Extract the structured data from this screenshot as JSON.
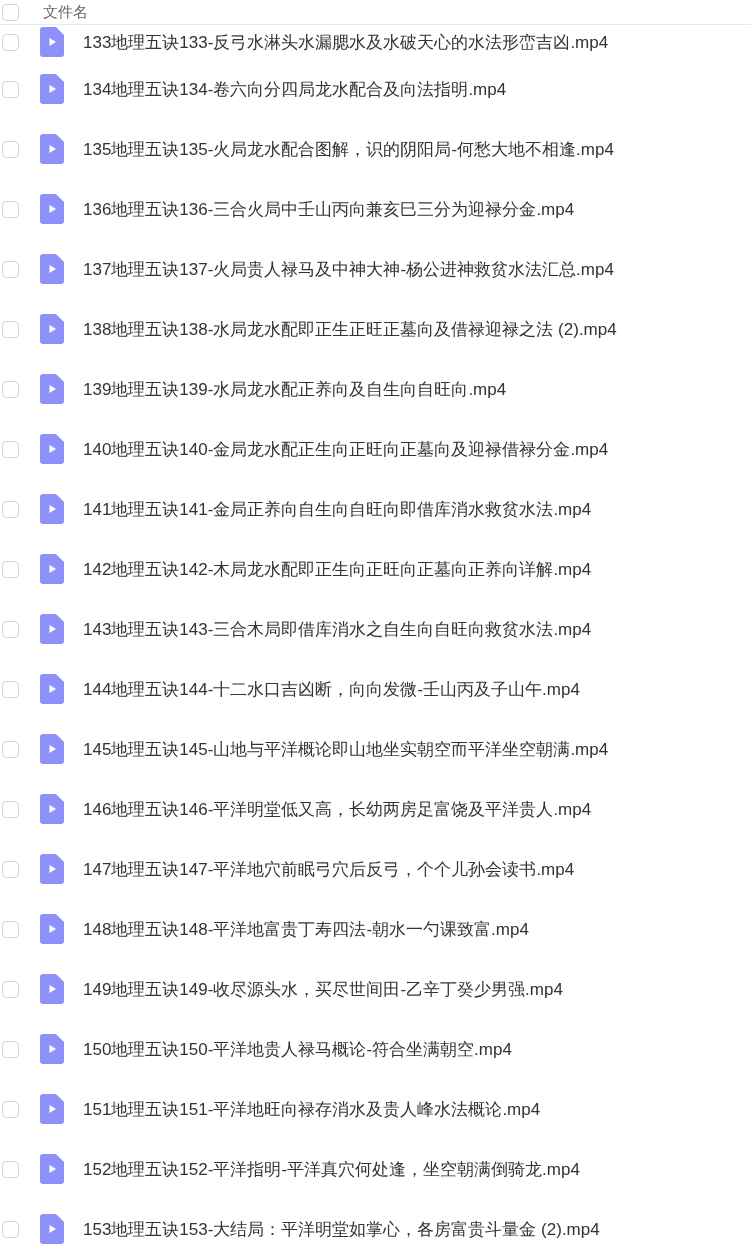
{
  "header": {
    "checked": false,
    "label": "文件名"
  },
  "files": [
    {
      "name": "133地理五诀133-反弓水淋头水漏腮水及水破天心的水法形峦吉凶.mp4",
      "checked": false
    },
    {
      "name": "134地理五诀134-卷六向分四局龙水配合及向法指明.mp4",
      "checked": false
    },
    {
      "name": "135地理五诀135-火局龙水配合图解，识的阴阳局-何愁大地不相逢.mp4",
      "checked": false
    },
    {
      "name": "136地理五诀136-三合火局中壬山丙向兼亥巳三分为迎禄分金.mp4",
      "checked": false
    },
    {
      "name": "137地理五诀137-火局贵人禄马及中神大神-杨公进神救贫水法汇总.mp4",
      "checked": false
    },
    {
      "name": "138地理五诀138-水局龙水配即正生正旺正墓向及借禄迎禄之法 (2).mp4",
      "checked": false
    },
    {
      "name": "139地理五诀139-水局龙水配正养向及自生向自旺向.mp4",
      "checked": false
    },
    {
      "name": "140地理五诀140-金局龙水配正生向正旺向正墓向及迎禄借禄分金.mp4",
      "checked": false
    },
    {
      "name": "141地理五诀141-金局正养向自生向自旺向即借库消水救贫水法.mp4",
      "checked": false
    },
    {
      "name": "142地理五诀142-木局龙水配即正生向正旺向正墓向正养向详解.mp4",
      "checked": false
    },
    {
      "name": "143地理五诀143-三合木局即借库消水之自生向自旺向救贫水法.mp4",
      "checked": false
    },
    {
      "name": "144地理五诀144-十二水口吉凶断，向向发微-壬山丙及子山午.mp4",
      "checked": false
    },
    {
      "name": "145地理五诀145-山地与平洋概论即山地坐实朝空而平洋坐空朝满.mp4",
      "checked": false
    },
    {
      "name": "146地理五诀146-平洋明堂低又高，长幼两房足富饶及平洋贵人.mp4",
      "checked": false
    },
    {
      "name": "147地理五诀147-平洋地穴前眠弓穴后反弓，个个儿孙会读书.mp4",
      "checked": false
    },
    {
      "name": "148地理五诀148-平洋地富贵丁寿四法-朝水一勺课致富.mp4",
      "checked": false
    },
    {
      "name": "149地理五诀149-收尽源头水，买尽世间田-乙辛丁癸少男强.mp4",
      "checked": false
    },
    {
      "name": "150地理五诀150-平洋地贵人禄马概论-符合坐满朝空.mp4",
      "checked": false
    },
    {
      "name": "151地理五诀151-平洋地旺向禄存消水及贵人峰水法概论.mp4",
      "checked": false
    },
    {
      "name": "152地理五诀152-平洋指明-平洋真穴何处逢，坐空朝满倒骑龙.mp4",
      "checked": false
    },
    {
      "name": "153地理五诀153-大结局：平洋明堂如掌心，各房富贵斗量金 (2).mp4",
      "checked": false
    }
  ]
}
